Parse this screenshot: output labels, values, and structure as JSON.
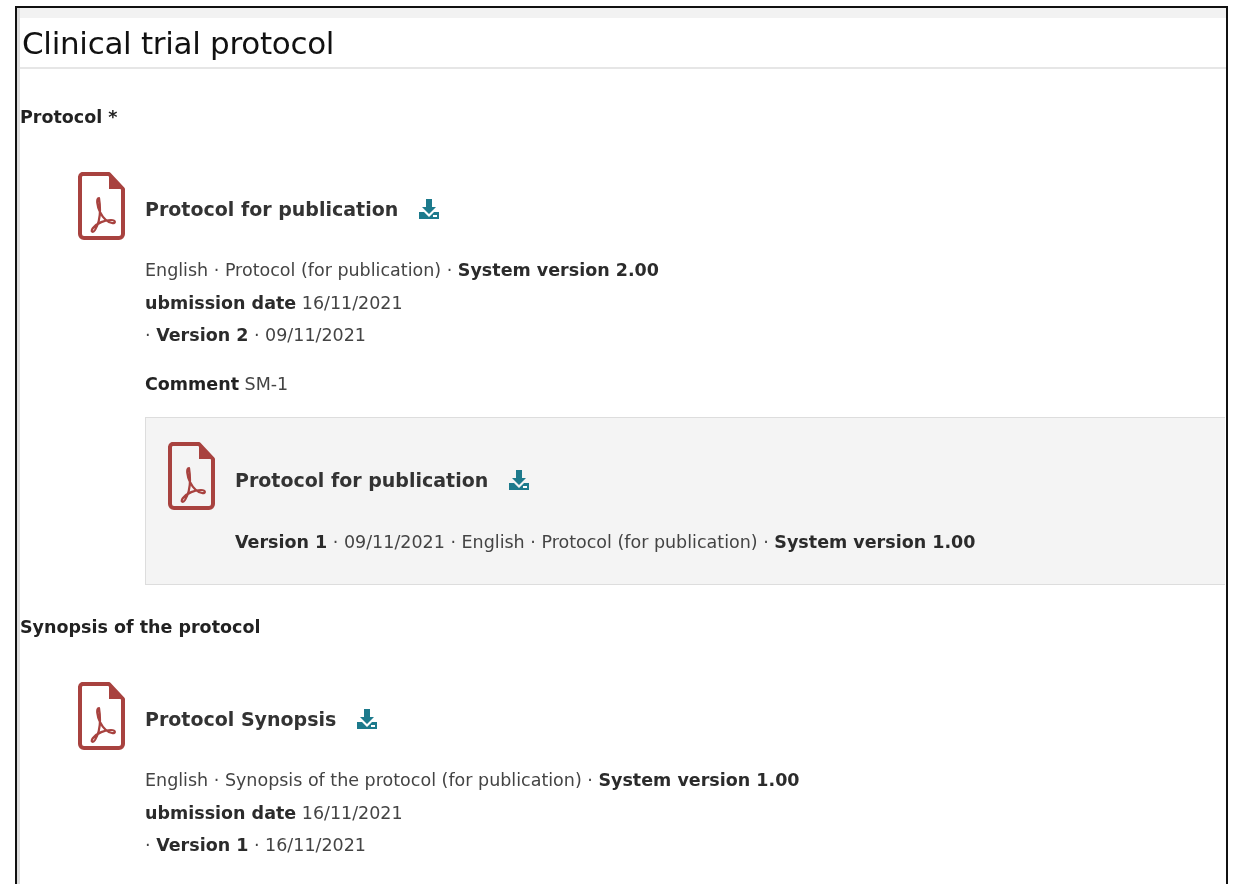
{
  "page": {
    "title": "Clinical trial protocol"
  },
  "sections": [
    {
      "heading": "Protocol *",
      "documents": [
        {
          "name": "Protocol for publication",
          "meta_lines": [
            "English · Protocol (for publication) · **System version 2.00**",
            "**ubmission date** 16/11/2021",
            "· **Version 2** · 09/11/2021"
          ],
          "comment": "**Comment** SM-1",
          "previous_versions": [
            {
              "name": "Protocol for publication",
              "meta_lines": [
                "**Version 1** · 09/11/2021 · English · Protocol (for publication) · **System version 1.00**"
              ]
            }
          ]
        }
      ]
    },
    {
      "heading": "Synopsis of the protocol",
      "documents": [
        {
          "name": "Protocol Synopsis",
          "meta_lines": [
            "English · Synopsis of the protocol (for publication) · **System version 1.00**",
            "**ubmission date** 16/11/2021",
            "· **Version 1** · 16/11/2021"
          ]
        }
      ]
    }
  ]
}
